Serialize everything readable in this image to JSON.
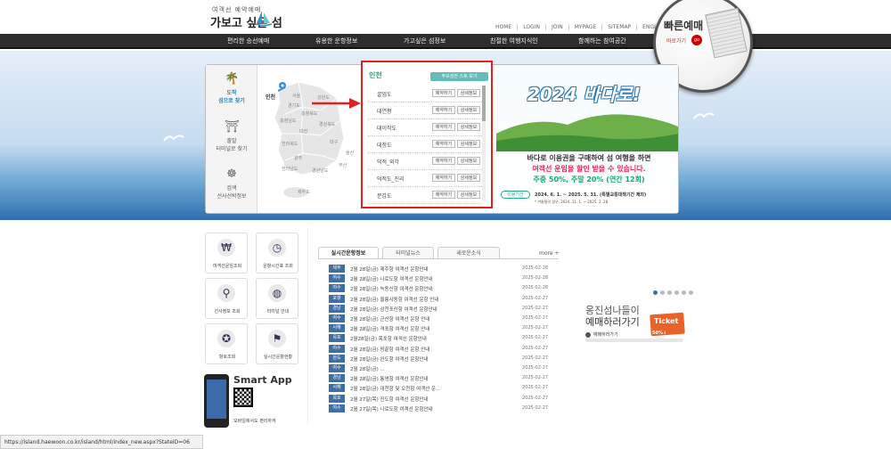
{
  "header": {
    "logo_small": "여객선 예약예매",
    "logo_main": "가보고 싶은 섬",
    "util_links": [
      "HOME",
      "LOGIN",
      "JOIN",
      "MYPAGE",
      "SITEMAP",
      "ENGLISH"
    ],
    "nav": [
      "편리한 승선예매",
      "유용한 운항정보",
      "가고싶은 섬정보",
      "친절한 여행지식인",
      "함께하는 참여공간"
    ]
  },
  "quick": {
    "title": "빠른예매",
    "subtitle": "바로가기",
    "go": "go"
  },
  "side_tabs": [
    {
      "label": "도착\n섬으로 찾기",
      "icon": "palm-tree-icon"
    },
    {
      "label": "출발\n터미널로 찾기",
      "icon": "terminal-icon"
    },
    {
      "label": "검색\n선사선박정보",
      "icon": "ship-wheel-icon"
    }
  ],
  "map": {
    "regions": [
      "인천",
      "서울",
      "강원도",
      "경기도",
      "충청북도",
      "충청남도",
      "경상북도",
      "대구",
      "전라북도",
      "울산",
      "광주",
      "부산",
      "전라남도",
      "경상남도",
      "제주도",
      "대전"
    ]
  },
  "terminal": {
    "title": "인천",
    "all_button": "주요섬전 스토 보기",
    "reserve_label": "예약하기",
    "detail_label": "상세정보",
    "islands": [
      "굴업도",
      "대연평",
      "대이작도",
      "대청도",
      "덕적_외각",
      "덕적도_진리",
      "문갑도",
      "미법"
    ]
  },
  "banner": {
    "title": "2024 바다로!",
    "line1": "바다로 이용권을 구매하여 섬 여행을 하면",
    "line2": "여객선 운임을 할인 받을 수 있습니다.",
    "line3": "주중 50%, 주말 20% (연간 12회)",
    "period_tag": "이용기간",
    "period": "2024. 6. 1. ~ 2025. 5. 31. (특별교통대책기간 제외)",
    "note": "* 겨울철의 경우, 2024. 11. 1. ~ 2025. 2. 28."
  },
  "quick_menu": [
    {
      "label": "여객선운임조회",
      "icon": "money-icon"
    },
    {
      "label": "운항시간표 조회",
      "icon": "clock-icon"
    },
    {
      "label": "선사정보 조회",
      "icon": "search-icon"
    },
    {
      "label": "터미널 안내",
      "icon": "globe-icon"
    },
    {
      "label": "항로조회",
      "icon": "compass-icon"
    },
    {
      "label": "실시간운항현황",
      "icon": "flag-icon"
    }
  ],
  "smart_app": {
    "title": "Smart App",
    "subtitle": "모바일에서도 편리하게"
  },
  "news": {
    "tabs": [
      "실시간운항정보",
      "터미널뉴스",
      "새로운소식"
    ],
    "more": "more +",
    "items": [
      {
        "region": "제주",
        "title": "2월 28일(금) 제주항 여객선 운항안내",
        "date": "2025-02-28"
      },
      {
        "region": "여수",
        "title": "2월 28일(금) 나로도항 여객선 운항안내",
        "date": "2025-02-28"
      },
      {
        "region": "여수",
        "title": "2월 28일(금) 녹동신항 여객선 운항안내",
        "date": "2025-02-28"
      },
      {
        "region": "포항",
        "title": "2월 28일(금) 울릉사동항 여객선 운항 안내",
        "date": "2025-02-27"
      },
      {
        "region": "경남",
        "title": "2월 28일(금) 삼천포신항 여객선 운항안내",
        "date": "2025-02-27"
      },
      {
        "region": "여수",
        "title": "2월 28일(금) 군산항 여객선 운항 안내",
        "date": "2025-02-27"
      },
      {
        "region": "서해",
        "title": "2월 28일(금) 격포항 여객선 운항 안내",
        "date": "2025-02-27"
      },
      {
        "region": "목포",
        "title": "2월28일(금) 목포항 여객선 운항안내",
        "date": "2025-02-27"
      },
      {
        "region": "여수",
        "title": "2월 28일(금) 땅끝항 여객선 운항 안내",
        "date": "2025-02-27"
      },
      {
        "region": "완도",
        "title": "2월 28일(금) 완도항 여객선 운항안내",
        "date": "2025-02-27"
      },
      {
        "region": "여수",
        "title": "2월 28일(금) ...",
        "date": "2025-02-27"
      },
      {
        "region": "경남",
        "title": "2월 28일(금) 통영항 여객선 운항안내",
        "date": "2025-02-27"
      },
      {
        "region": "서해",
        "title": "2월 28일(금) 대천항 및 오천항 여객선 운...",
        "date": "2025-02-27"
      },
      {
        "region": "목포",
        "title": "2월 27일(목) 진도항 여객선 운항안내",
        "date": "2025-02-27"
      },
      {
        "region": "여수",
        "title": "2월 27일(목) 나로도항 여객선 운항안내",
        "date": "2025-02-27"
      }
    ]
  },
  "promo": {
    "line1": "옹진섬나들이",
    "line2": "예매하러가기",
    "go": "예매하러가기",
    "ticket": "Ticket",
    "ticket_sub": "50%↓"
  },
  "status_bar": "https://island.haewoon.co.kr/island/html/index_new.aspx?StateID=06",
  "colors": {
    "accent": "#3e6ea3",
    "highlight": "#dd2222",
    "nav_bg": "#2d2d2d"
  }
}
